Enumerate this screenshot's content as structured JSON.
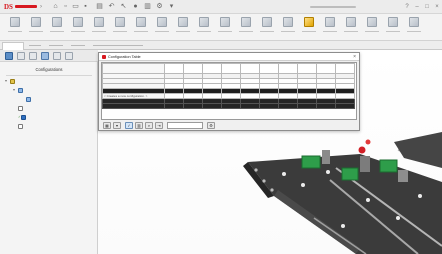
{
  "app": {
    "logo_text": "",
    "document_title": ""
  },
  "ribbon": {
    "buttons": [
      {
        "label": "",
        "active": false
      },
      {
        "label": "",
        "active": false
      },
      {
        "label": "",
        "active": false
      },
      {
        "label": "",
        "active": false
      },
      {
        "label": "",
        "active": false
      },
      {
        "label": "",
        "active": false
      },
      {
        "label": "",
        "active": false
      },
      {
        "label": "",
        "active": false
      },
      {
        "label": "",
        "active": false
      },
      {
        "label": "",
        "active": false
      },
      {
        "label": "",
        "active": false
      },
      {
        "label": "",
        "active": false
      },
      {
        "label": "",
        "active": false
      },
      {
        "label": "",
        "active": false
      },
      {
        "label": "",
        "active": true
      },
      {
        "label": "",
        "active": false
      },
      {
        "label": "",
        "active": false
      },
      {
        "label": "",
        "active": false
      },
      {
        "label": "",
        "active": false
      },
      {
        "label": "",
        "active": false
      }
    ]
  },
  "command_tabs": [
    {
      "label": "",
      "selected": true
    },
    {
      "label": "",
      "selected": false
    },
    {
      "label": "",
      "selected": false
    },
    {
      "label": "",
      "selected": false
    },
    {
      "label": "",
      "selected": false
    }
  ],
  "feature_manager": {
    "title": "Configurations",
    "tree": [
      {
        "label": "",
        "icon": "assembly-icon",
        "level": 0,
        "expanded": true,
        "style": "normal"
      },
      {
        "label": "",
        "icon": "table-icon",
        "level": 1,
        "expanded": true,
        "style": "normal"
      },
      {
        "label": "",
        "icon": "table-icon",
        "level": 2,
        "expanded": false,
        "style": "highlight"
      },
      {
        "label": "",
        "icon": "configuration-icon",
        "level": 1,
        "expanded": false,
        "style": "dim"
      },
      {
        "label": "",
        "icon": "configuration-active-icon",
        "level": 1,
        "expanded": false,
        "style": "active"
      },
      {
        "label": "",
        "icon": "configuration-icon",
        "level": 1,
        "expanded": false,
        "style": "dim"
      }
    ]
  },
  "viewport": {
    "label": ""
  },
  "config_table": {
    "title": "Configuration Table",
    "corner_header": "",
    "columns": [
      "",
      "",
      "",
      "",
      "",
      "",
      "",
      "",
      "",
      ""
    ],
    "subheader": [
      "",
      "",
      "",
      "",
      "",
      "",
      "",
      "",
      "",
      ""
    ],
    "rows": [
      {
        "name": "",
        "cells": [
          "",
          "",
          "",
          "",
          "",
          "",
          "",
          "",
          "",
          ""
        ],
        "style": "normal"
      },
      {
        "name": "",
        "cells": [
          "",
          "",
          "",
          "",
          "",
          "",
          "",
          "",
          "",
          ""
        ],
        "style": "normal"
      },
      {
        "name": "",
        "cells": [
          "",
          "",
          "",
          "",
          "",
          "",
          "",
          "",
          "",
          ""
        ],
        "style": "selected"
      },
      {
        "name": "< Creates a new configuration. >",
        "cells": [
          "",
          "",
          "",
          "",
          "",
          "",
          "",
          "",
          "",
          ""
        ],
        "style": "new"
      }
    ],
    "bottom_combo_value": ""
  }
}
